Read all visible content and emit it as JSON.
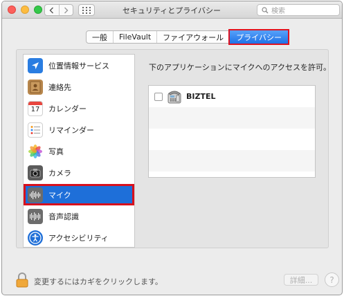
{
  "window": {
    "title": "セキュリティとプライバシー"
  },
  "search": {
    "placeholder": "検索"
  },
  "tabs": [
    {
      "label": "一般"
    },
    {
      "label": "FileVault"
    },
    {
      "label": "ファイアウォール"
    },
    {
      "label": "プライバシー",
      "active": true
    }
  ],
  "sidebar": {
    "items": [
      {
        "label": "位置情報サービス",
        "icon": "location-icon"
      },
      {
        "label": "連絡先",
        "icon": "contacts-icon"
      },
      {
        "label": "カレンダー",
        "icon": "calendar-icon",
        "icon_text": "17"
      },
      {
        "label": "リマインダー",
        "icon": "reminders-icon"
      },
      {
        "label": "写真",
        "icon": "photos-icon"
      },
      {
        "label": "カメラ",
        "icon": "camera-icon"
      },
      {
        "label": "マイク",
        "icon": "microphone-icon",
        "selected": true
      },
      {
        "label": "音声認識",
        "icon": "speech-recognition-icon"
      },
      {
        "label": "アクセシビリティ",
        "icon": "accessibility-icon"
      }
    ]
  },
  "main": {
    "description": "下のアプリケーションにマイクへのアクセスを許可。",
    "apps": [
      {
        "name": "BIZTEL",
        "checked": false,
        "icon": "phone-icon"
      }
    ]
  },
  "footer": {
    "lock_text": "変更するにはカギをクリックします。",
    "advanced_label": "詳細...",
    "help_label": "?"
  },
  "colors": {
    "accent": "#1e6fd9",
    "highlight_border": "#d8101c"
  }
}
